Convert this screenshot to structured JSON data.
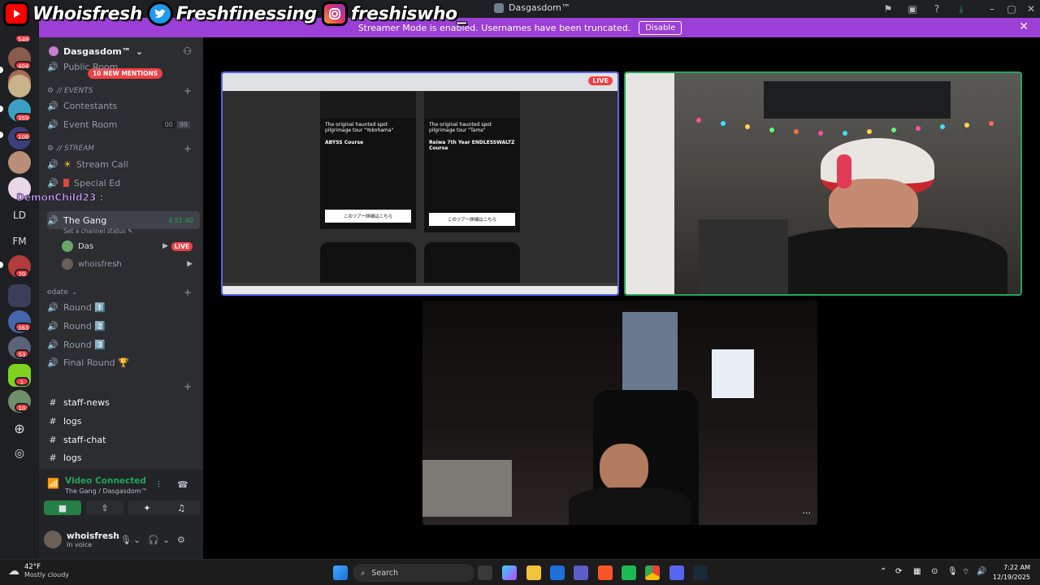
{
  "window": {
    "title": "Dasgasdom™"
  },
  "overlay": {
    "youtube": "Whoisfresh",
    "twitter": "Freshfinessing",
    "instagram": "freshiswho_"
  },
  "banner": {
    "text": "Streamer Mode is enabled. Usernames have been truncated.",
    "button": "Disable"
  },
  "rail": {
    "badges": [
      "549",
      "404",
      "359",
      "106",
      "70",
      "363",
      "53",
      "1",
      "10"
    ],
    "text_servers": [
      "LD",
      "FM"
    ]
  },
  "server": {
    "name": "Dasgasdom™",
    "mentions": "10 NEW MENTIONS"
  },
  "channels": {
    "public_room": "Public Room",
    "events_category": "// Events",
    "contestants": "Contestants",
    "event_room": "Event Room",
    "event_room_count_a": "00",
    "event_room_count_b": "99",
    "stream_category": "// STREAM",
    "stream_call": "Stream Call",
    "special_ed": "Special Ed",
    "overlay_user": "DemonChild23 :",
    "the_gang": "The Gang",
    "the_gang_time": "4:51:40",
    "channel_status": "Set a channel status",
    "member_das": "Das",
    "member_das_live": "LIVE",
    "member_fresh": "whoisfresh",
    "edate_category": "edate",
    "round1": "Round 1️⃣",
    "round2": "Round 2️⃣",
    "round3": "Round 3️⃣",
    "final_round": "Final Round 🏆",
    "staff_news": "staff-news",
    "logs": "logs",
    "staff_chat": "staff-chat",
    "logs2": "logs"
  },
  "voice": {
    "status": "Video Connected",
    "location": "The Gang / Dasgasdom™"
  },
  "user": {
    "name": "whoisfresh",
    "status": "In voice"
  },
  "tiles": {
    "screen_live": "LIVE",
    "card1_title": "The original haunted spot pilgrimage tour \"Yokohama\"",
    "card1_course": "ABYSS Course",
    "card1_button": "このツアー詳細はこちら",
    "card2_title": "The original haunted spot pilgrimage tour \"Tama\"",
    "card2_course": "Reiwa 7th Year ENDLESSWALTZ Course",
    "card2_button": "このツアー詳細はこちら",
    "more": "···"
  },
  "taskbar": {
    "weather_temp": "42°F",
    "weather_desc": "Mostly cloudy",
    "search": "Search",
    "time": "7:22 AM",
    "date": "12/19/2025"
  }
}
